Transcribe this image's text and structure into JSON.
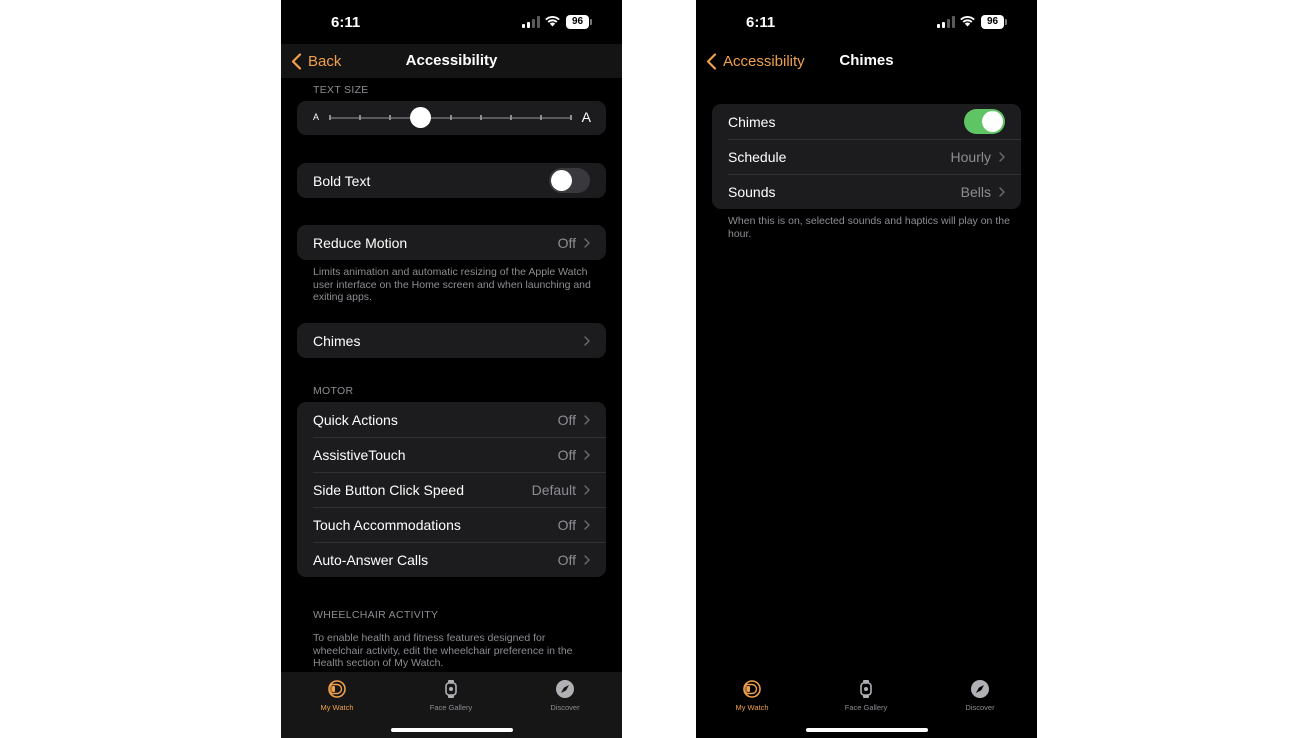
{
  "status_bar": {
    "time": "6:11",
    "battery": "96"
  },
  "colors": {
    "accent": "#f0a04b",
    "toggle_on": "#5fc564",
    "background": "#000000",
    "cell": "#1c1c1e",
    "secondary_text": "#8d8d93"
  },
  "left": {
    "nav": {
      "back_label": "Back",
      "title": "Accessibility"
    },
    "text_size": {
      "header": "TEXT SIZE",
      "small_label": "A",
      "large_label": "A",
      "steps": 9,
      "selected_step": 3
    },
    "bold_text": {
      "label": "Bold Text",
      "on": false
    },
    "reduce_motion": {
      "label": "Reduce Motion",
      "value": "Off",
      "footer": "Limits animation and automatic resizing of the Apple Watch user interface on the Home screen and when launching and exiting apps."
    },
    "chimes": {
      "label": "Chimes"
    },
    "motor": {
      "header": "MOTOR",
      "items": [
        {
          "label": "Quick Actions",
          "value": "Off"
        },
        {
          "label": "AssistiveTouch",
          "value": "Off"
        },
        {
          "label": "Side Button Click Speed",
          "value": "Default"
        },
        {
          "label": "Touch Accommodations",
          "value": "Off"
        },
        {
          "label": "Auto-Answer Calls",
          "value": "Off"
        }
      ]
    },
    "wheelchair": {
      "header": "WHEELCHAIR ACTIVITY",
      "footer": "To enable health and fitness features designed for wheelchair activity, edit the wheelchair preference in the Health section of My Watch."
    }
  },
  "right": {
    "nav": {
      "back_label": "Accessibility",
      "title": "Chimes"
    },
    "chimes_toggle": {
      "label": "Chimes",
      "on": true
    },
    "schedule": {
      "label": "Schedule",
      "value": "Hourly"
    },
    "sounds": {
      "label": "Sounds",
      "value": "Bells"
    },
    "footer": "When this is on, selected sounds and haptics will play on the hour."
  },
  "tabbar": {
    "tabs": [
      {
        "label": "My Watch",
        "icon": "watch-icon",
        "active": true
      },
      {
        "label": "Face Gallery",
        "icon": "watch-face-icon",
        "active": false
      },
      {
        "label": "Discover",
        "icon": "compass-icon",
        "active": false
      }
    ]
  }
}
